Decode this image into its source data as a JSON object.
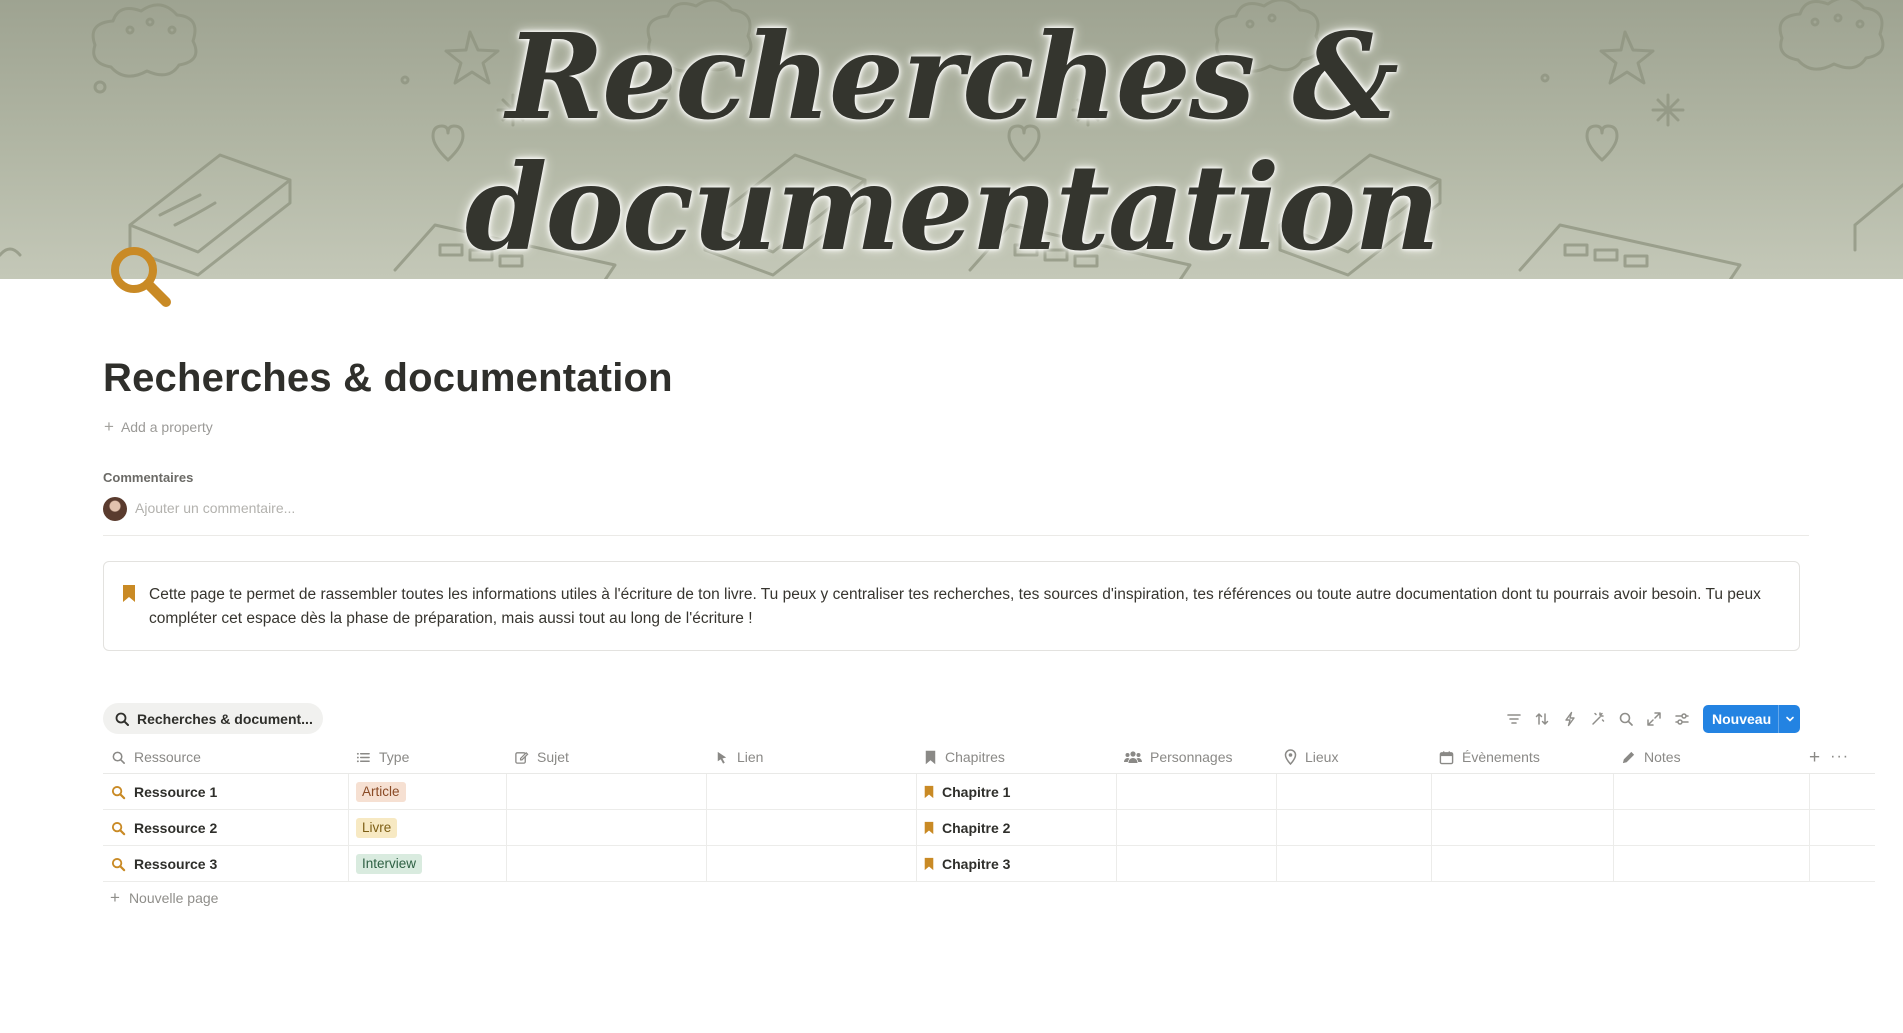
{
  "cover": {
    "title_line1": "Recherches &",
    "title_line2": "documentation"
  },
  "page": {
    "icon": "magnifying-glass-icon",
    "title": "Recherches & documentation",
    "add_property": "Add a property"
  },
  "comments": {
    "label": "Commentaires",
    "placeholder": "Ajouter un commentaire..."
  },
  "callout": {
    "icon": "bookmark-icon",
    "text": "Cette page te permet de rassembler toutes les informations utiles à l'écriture de ton livre. Tu peux y centraliser tes recherches, tes sources d'inspiration, tes références ou toute autre documentation dont tu pourrais avoir besoin. Tu peux compléter cet espace dès la phase de préparation, mais aussi tout au long de l'écriture !"
  },
  "database": {
    "view_tab": "Recherches & document...",
    "new_button": "Nouveau",
    "toolbar_icons": [
      "filter-icon",
      "sort-icon",
      "automation-icon",
      "customize-icon",
      "search-icon",
      "expand-icon",
      "settings-icon"
    ],
    "columns": [
      {
        "label": "Ressource",
        "icon": "search-icon"
      },
      {
        "label": "Type",
        "icon": "list-icon"
      },
      {
        "label": "Sujet",
        "icon": "edit-icon"
      },
      {
        "label": "Lien",
        "icon": "cursor-icon"
      },
      {
        "label": "Chapitres",
        "icon": "bookmark-icon"
      },
      {
        "label": "Personnages",
        "icon": "people-icon"
      },
      {
        "label": "Lieux",
        "icon": "pin-icon"
      },
      {
        "label": "Évènements",
        "icon": "calendar-icon"
      },
      {
        "label": "Notes",
        "icon": "pencil-icon"
      }
    ],
    "rows": [
      {
        "resource": "Ressource 1",
        "type": "Article",
        "chapter": "Chapitre 1"
      },
      {
        "resource": "Ressource 2",
        "type": "Livre",
        "chapter": "Chapitre 2"
      },
      {
        "resource": "Ressource 3",
        "type": "Interview",
        "chapter": "Chapitre 3"
      }
    ],
    "type_colors": {
      "Article": {
        "bg": "#f6e0d2",
        "fg": "#8a4a25"
      },
      "Livre": {
        "bg": "#f7e9c3",
        "fg": "#7d5e14"
      },
      "Interview": {
        "bg": "#d9ebdf",
        "fg": "#2e6043"
      }
    },
    "new_page": "Nouvelle page"
  },
  "colors": {
    "accent_blue": "#2383e2",
    "icon_gold": "#c98a25"
  }
}
